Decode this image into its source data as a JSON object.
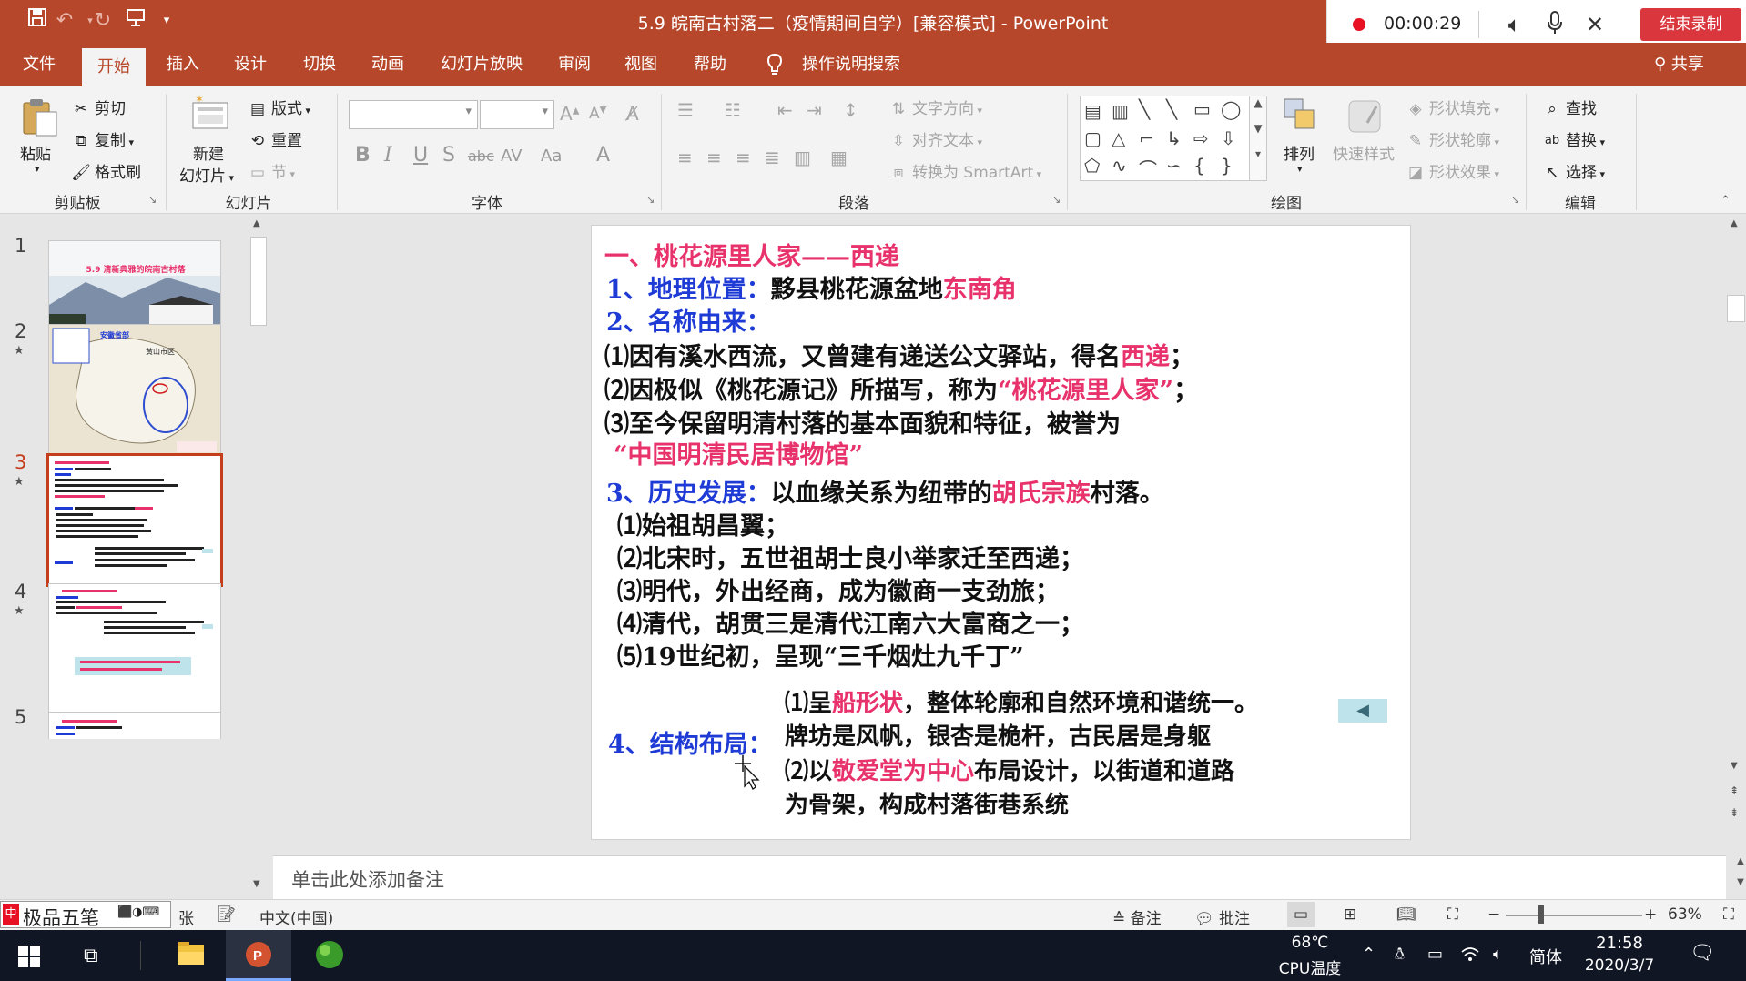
{
  "window": {
    "title": "5.9 皖南古村落二（疫情期间自学）[兼容模式] - PowerPoint",
    "accent": "#b7472a"
  },
  "recorder": {
    "time": "00:00:29",
    "stop_label": "结束录制"
  },
  "tabs": [
    "文件",
    "开始",
    "插入",
    "设计",
    "切换",
    "动画",
    "幻灯片放映",
    "审阅",
    "视图",
    "帮助",
    "操作说明搜索"
  ],
  "active_tab": "开始",
  "share_label": "共享",
  "ribbon": {
    "clipboard": {
      "paste": "粘贴",
      "cut": "剪切",
      "copy": "复制",
      "format_painter": "格式刷",
      "label": "剪贴板"
    },
    "slides": {
      "new_slide_line1": "新建",
      "new_slide_line2": "幻灯片",
      "layout": "版式",
      "reset": "重置",
      "section": "节",
      "label": "幻灯片"
    },
    "font": {
      "bold": "B",
      "italic": "I",
      "underline": "U",
      "shadow": "S",
      "strike": "abc",
      "spacing": "AV",
      "case": "Aa",
      "color": "A",
      "label": "字体"
    },
    "paragraph": {
      "text_direction": "文字方向",
      "align_text": "对齐文本",
      "smartart": "转换为 SmartArt",
      "label": "段落"
    },
    "drawing": {
      "arrange": "排列",
      "quick_styles": "快速样式",
      "shape_fill": "形状填充",
      "shape_outline": "形状轮廓",
      "shape_effects": "形状效果",
      "label": "绘图"
    },
    "editing": {
      "find": "查找",
      "replace": "替换",
      "select": "选择",
      "label": "编辑"
    }
  },
  "thumbnails": [
    {
      "num": "1",
      "star": false,
      "title": "5.9 清新典雅的皖南古村落"
    },
    {
      "num": "2",
      "star": true,
      "label_a": "黄山市区",
      "label_b": "安徽省部"
    },
    {
      "num": "3",
      "star": true,
      "selected": true
    },
    {
      "num": "4",
      "star": true
    },
    {
      "num": "5",
      "star": false
    }
  ],
  "slide": {
    "l1": "一、桃花源里人家——西递",
    "l2a": "1、地理位置：",
    "l2b": "黟县桃花源盆地",
    "l2c": "东南角",
    "l3": "2、名称由来：",
    "l4a": "⑴因有溪水西流，又曾建有递送公文驿站，得名",
    "l4b": "西递",
    "l4c": "；",
    "l5a": "⑵因极似《桃花源记》所描写，称为",
    "l5b": "“桃花源里人家”",
    "l5c": "；",
    "l6": "⑶至今保留明清村落的基本面貌和特征，被誉为",
    "l7": "“中国明清民居博物馆”",
    "l8a": "3、历史发展：",
    "l8b": "以血缘关系为纽带的",
    "l8c": "胡氏宗族",
    "l8d": "村落。",
    "l9": "⑴始祖胡昌翼；",
    "l10": "⑵北宋时，五世祖胡士良小举家迁至西递；",
    "l11": "⑶明代，外出经商，成为徽商一支劲旅；",
    "l12": "⑷清代，胡贯三是清代江南六大富商之一；",
    "l13": "⑸19世纪初，呈现“三千烟灶九千丁”",
    "l14": "4、结构布局：",
    "l15a": "⑴呈",
    "l15b": "船形状",
    "l15c": "，整体轮廓和自然环境和谐统一。",
    "l16": "牌坊是风帆，银杏是桅杆，古民居是身躯",
    "l17a": "⑵以",
    "l17b": "敬爱堂为中心",
    "l17c": "布局设计，以街道和道路",
    "l18": "为骨架，构成村落街巷系统",
    "back_icon": "◀"
  },
  "notes_placeholder": "单击此处添加备注",
  "status": {
    "ime_name": "极品五笔",
    "page_suffix": "张",
    "language": "中文(中国)",
    "notes": "备注",
    "comments": "批注",
    "zoom": "63%"
  },
  "taskbar": {
    "temp": "68℃",
    "temp_label": "CPU温度",
    "ime": "简体",
    "time": "21:58",
    "date": "2020/3/7"
  }
}
